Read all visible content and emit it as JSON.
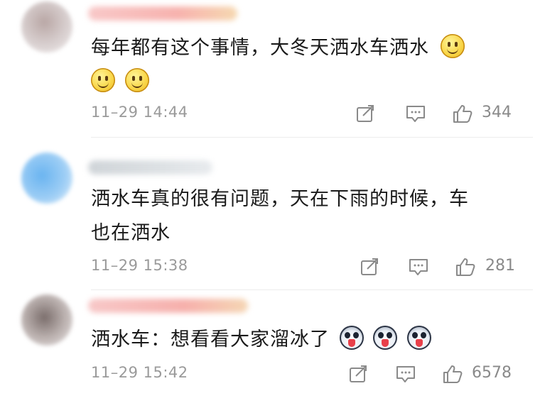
{
  "comments": [
    {
      "text": "每年都有这个事情，大冬天洒水车洒水",
      "time": "11–29 14:44",
      "likes": "344",
      "emojis": [
        "smile-icon",
        "smile-icon",
        "smile-icon"
      ]
    },
    {
      "text_line1": "洒水车真的很有问题，天在下雨的时候，车",
      "text_line2": "也在洒水",
      "time": "11–29 15:38",
      "likes": "281"
    },
    {
      "text": "洒水车：想看看大家溜冰了",
      "time": "11–29 15:42",
      "likes": "6578",
      "emojis": [
        "husky-icon",
        "husky-icon",
        "husky-icon"
      ]
    }
  ],
  "colors": {
    "text": "#1a1a1a",
    "meta": "#9a9a9a",
    "divider": "#ececec"
  }
}
